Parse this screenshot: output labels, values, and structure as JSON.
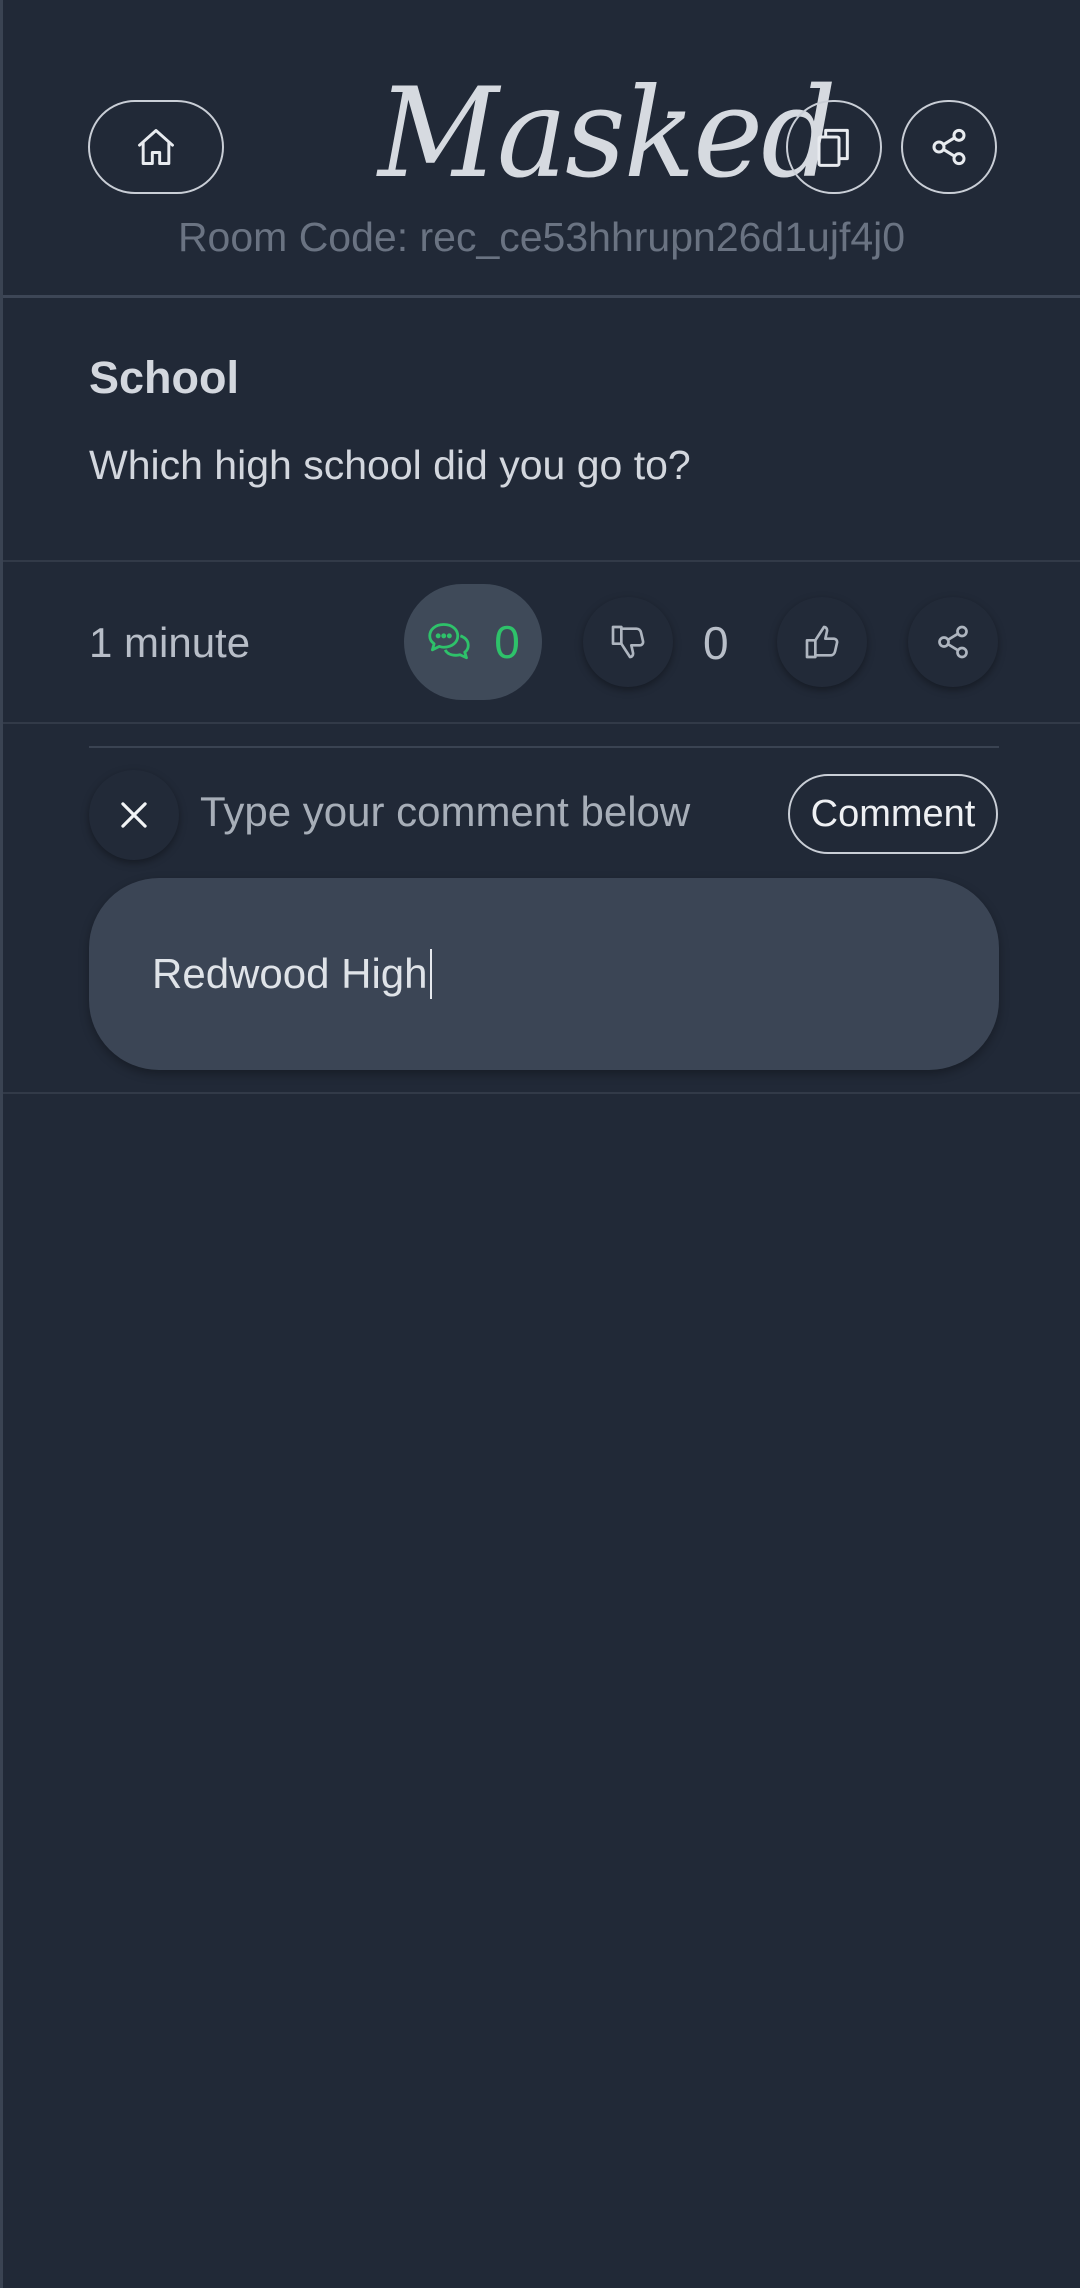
{
  "header": {
    "logo_text": "Masked",
    "room_code": "Room Code: rec_ce53hhrupn26d1ujf4j0",
    "icons": {
      "home": "home-icon",
      "copy": "copy-icon",
      "share": "share-icon"
    }
  },
  "question": {
    "title": "School",
    "text": "Which high school did you go to?"
  },
  "actions": {
    "time": "1 minute",
    "comment_count": "0",
    "vote_count": "0",
    "accent_color": "#2ec26a",
    "icons": {
      "comments": "chat-bubbles-icon",
      "dislike": "thumbs-down-icon",
      "like": "thumbs-up-icon",
      "share": "share-icon"
    }
  },
  "composer": {
    "prompt": "Type your comment below",
    "submit_label": "Comment",
    "input_value": "Redwood High",
    "icons": {
      "close": "close-icon"
    }
  }
}
